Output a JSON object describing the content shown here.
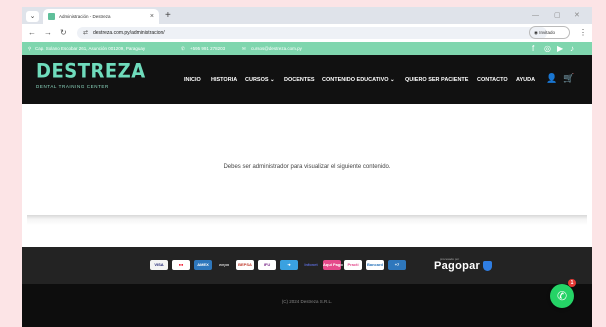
{
  "browser": {
    "tab_title": "Administración - Destreza",
    "tab_dropdown_icon": "⌄",
    "close_icon": "×",
    "new_tab_icon": "+",
    "minimize_icon": "—",
    "restore_icon": "▢",
    "window_close_icon": "✕",
    "back_icon": "←",
    "forward_icon": "→",
    "reload_icon": "↻",
    "site_info_icon": "⇄",
    "url": "destreza.com.py/administracion/",
    "guest_icon": "◉",
    "guest_label": "Invitado",
    "menu_icon": "⋮"
  },
  "topbar": {
    "address": "Cap. Solano Escobar 261, Asunción 001209, Paraguay",
    "phone": "+595 991 278203",
    "email": "cursos@destreza.com.py",
    "location_icon": "⚲",
    "phone_icon": "✆",
    "mail_icon": "✉",
    "social": [
      "f",
      "◎",
      "▶",
      "♪"
    ]
  },
  "header": {
    "logo_text": "DESTREZA",
    "logo_subtitle": "DENTAL TRAINING CENTER",
    "menu": [
      "INICIO",
      "HISTORIA",
      "CURSOS ⌄",
      "DOCENTES",
      "CONTENIDO EDUCATIVO ⌄",
      "QUIERO SER PACIENTE",
      "CONTACTO",
      "AYUDA"
    ],
    "user_icon": "👤",
    "cart_icon": "🛒"
  },
  "content": {
    "notice": "Debes ser administrador para visualizar el siguiente contenido."
  },
  "payments": {
    "logos": [
      "VISA",
      "●●",
      "AMEX",
      "wepa",
      "BEPSA",
      "IFU",
      "➜",
      "Infonet",
      "Aqui Pago",
      "Practi",
      "Bancard",
      "+7"
    ],
    "pagopar_pre": "procesado por",
    "pagopar": "Pagopar"
  },
  "footer": {
    "copyright": "(C) 2024 Destreza S.R.L."
  },
  "whatsapp": {
    "icon": "✆",
    "badge": "1"
  }
}
